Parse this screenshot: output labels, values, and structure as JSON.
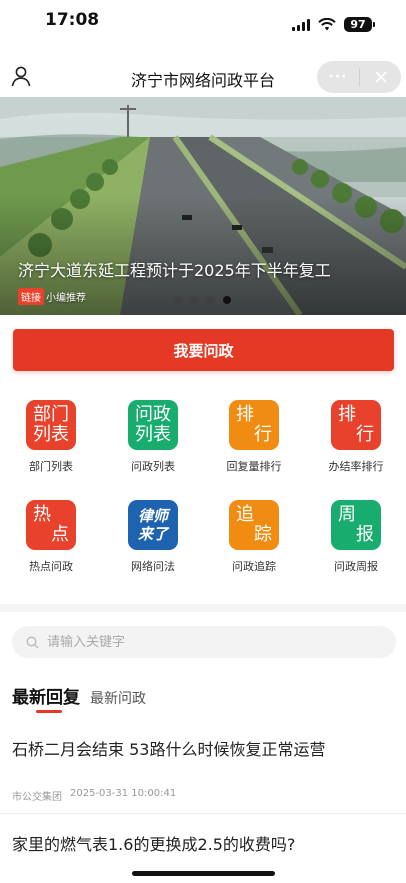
{
  "status_bar": {
    "time": "17:08",
    "battery": "97"
  },
  "nav": {
    "title": "济宁市网络问政平台",
    "more": "···"
  },
  "banner": {
    "caption": "济宁大道东延工程预计于2025年下半年复工",
    "tag": "链接",
    "editor": "小编推荐",
    "slide_count": 4,
    "active_slide": 4
  },
  "ask_button": {
    "label": "我要问政"
  },
  "grid": [
    {
      "tile": [
        "部门",
        "列表"
      ],
      "label": "部门列表",
      "color": "#e8412c",
      "icon": "department-list-icon"
    },
    {
      "tile": [
        "问政",
        "列表"
      ],
      "label": "问政列表",
      "color": "#18ac6e",
      "icon": "inquiry-list-icon"
    },
    {
      "tile": [
        "排",
        "行"
      ],
      "label": "回复量排行",
      "color": "#f08c12",
      "icon": "reply-ranking-icon"
    },
    {
      "tile": [
        "排",
        "行"
      ],
      "label": "办结率排行",
      "color": "#e8412c",
      "icon": "completion-ranking-icon"
    },
    {
      "tile": [
        "热",
        "点"
      ],
      "label": "热点问政",
      "color": "#e8412c",
      "icon": "hot-topics-icon"
    },
    {
      "tile": [
        "律师",
        "来了"
      ],
      "label": "网络问法",
      "color": "#1d63b0",
      "icon": "lawyer-icon"
    },
    {
      "tile": [
        "追",
        "踪"
      ],
      "label": "问政追踪",
      "color": "#f08c12",
      "icon": "tracking-icon"
    },
    {
      "tile": [
        "周",
        "报"
      ],
      "label": "问政周报",
      "color": "#18ac6e",
      "icon": "weekly-report-icon"
    }
  ],
  "search": {
    "placeholder": "请输入关键字"
  },
  "tabs": {
    "active": "最新回复",
    "inactive": "最新问政"
  },
  "news": [
    {
      "title": "石桥二月会结束 53路什么时候恢复正常运营",
      "department": "市公交集团",
      "time": "2025-03-31 10:00:41"
    },
    {
      "title": "家里的燃气表1.6的更换成2.5的收费吗?",
      "department": "",
      "time": ""
    }
  ],
  "colors": {
    "accent": "#e43a25"
  }
}
